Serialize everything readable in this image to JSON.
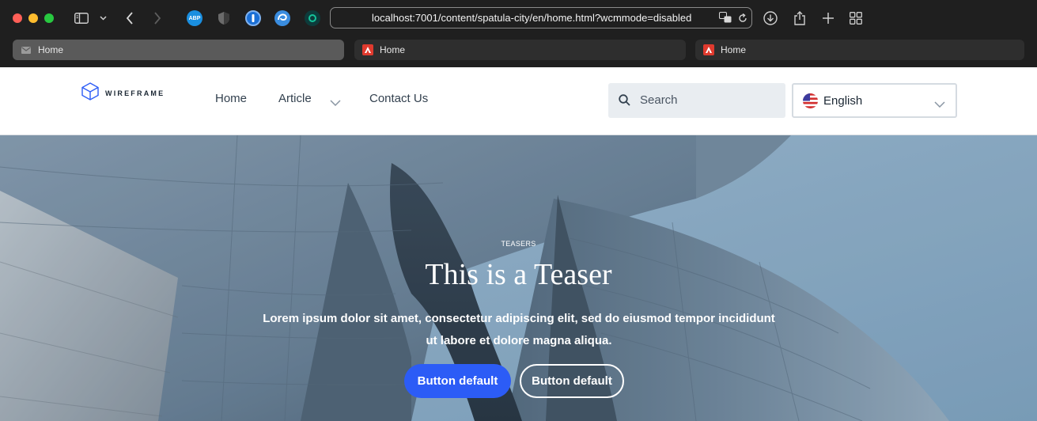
{
  "browser": {
    "url": "localhost:7001/content/spatula-city/en/home.html?wcmmode=disabled",
    "tabs": [
      {
        "label": "Home",
        "active": true,
        "favicon": "envelope-icon"
      },
      {
        "label": "Home",
        "active": false,
        "favicon": "adobe-icon"
      },
      {
        "label": "Home",
        "active": false,
        "favicon": "adobe-icon"
      }
    ],
    "extensions": [
      {
        "name": "abp-icon",
        "text": "ABP",
        "color": "#1a8fe0"
      },
      {
        "name": "shield-icon",
        "color": "#7a7a7a"
      },
      {
        "name": "onepassword-icon",
        "color": "#1a6fd6"
      },
      {
        "name": "edge-icon",
        "color": "#3a8de0"
      },
      {
        "name": "grammarly-icon",
        "color": "#15c39a"
      }
    ]
  },
  "site": {
    "logo_text": "WIREFRAME",
    "nav": [
      {
        "label": "Home"
      },
      {
        "label": "Article",
        "has_dropdown": true
      },
      {
        "label": "Contact Us"
      }
    ],
    "search_placeholder": "Search",
    "language": "English"
  },
  "hero": {
    "pretitle": "TEASERS",
    "title": "This is a Teaser",
    "description": "Lorem ipsum dolor sit amet, consectetur adipiscing elit, sed do eiusmod tempor incididunt ut labore et dolore magna aliqua.",
    "primary_button": "Button default",
    "secondary_button": "Button default"
  },
  "colors": {
    "accent": "#2c5cf6",
    "header_bg": "#ffffff",
    "sky": "#8fb2cd"
  }
}
